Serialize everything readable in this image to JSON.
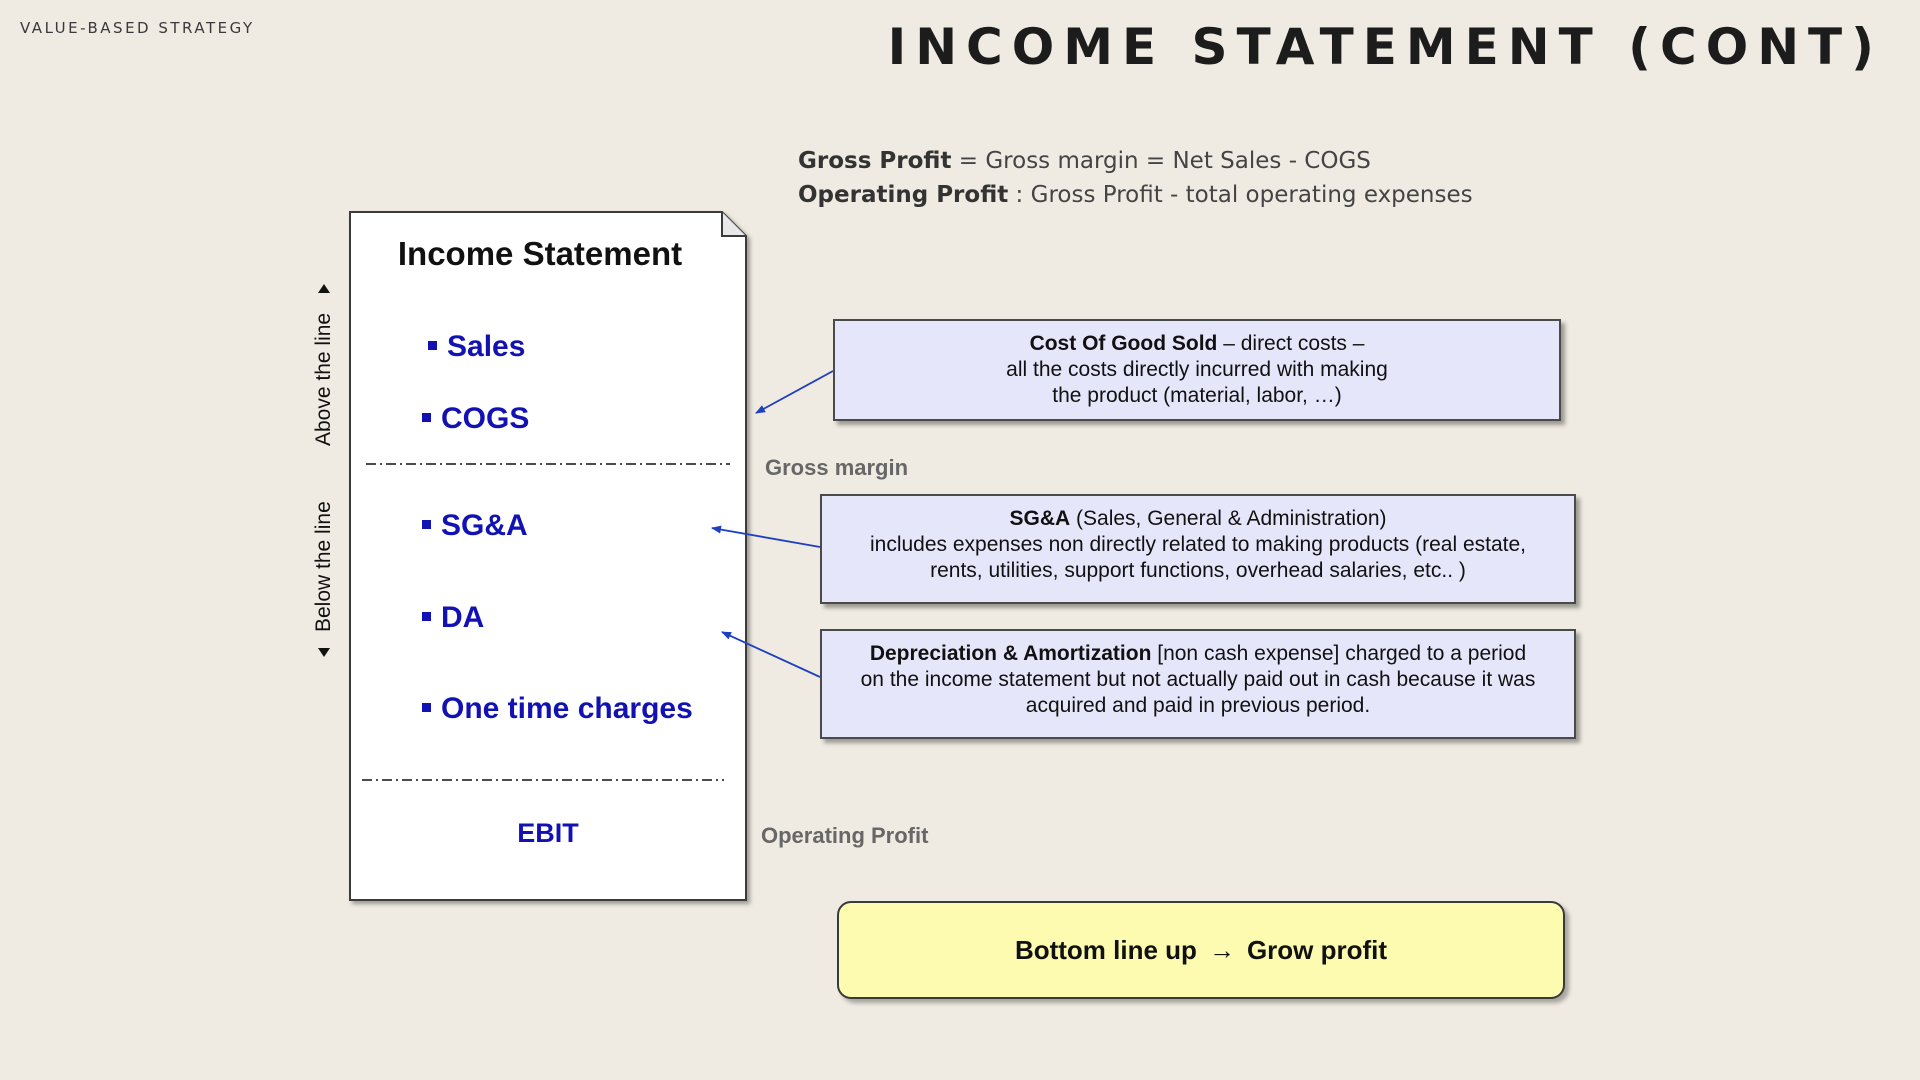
{
  "header": {
    "section_label": "VALUE-BASED STRATEGY",
    "title": "INCOME STATEMENT (CONT)"
  },
  "formulas": {
    "gross_profit_term": "Gross Profit",
    "gross_profit_def": " = Gross margin = Net Sales - COGS",
    "operating_profit_term": "Operating Profit",
    "operating_profit_def": " : Gross Profit - total operating expenses"
  },
  "income_statement": {
    "title": "Income Statement",
    "items": [
      "Sales",
      "COGS",
      "SG&A",
      "DA",
      "One time charges"
    ],
    "result": "EBIT"
  },
  "line_labels": {
    "above": "Above the line",
    "below": "Below  the line"
  },
  "side_notes": {
    "gross_margin": "Gross margin",
    "operating_profit": "Operating Profit"
  },
  "callouts": {
    "cogs": {
      "term": "Cost Of Good Sold",
      "line1": " – direct costs –",
      "line2": "all the costs directly incurred with making",
      "line3": "the product (material,  labor, …)"
    },
    "sga": {
      "term": "SG&A",
      "line1": " (Sales, General & Administration)",
      "line2": "includes expenses non directly related to making products (real estate,",
      "line3": "rents, utilities, support functions, overhead salaries, etc.. )"
    },
    "da": {
      "term": "Depreciation & Amortization",
      "line1": "  [non cash expense] charged to a period",
      "line2": "on the income statement but not actually paid out in cash because it was",
      "line3": "acquired and paid in previous period."
    }
  },
  "bottom_box": {
    "left": "Bottom line up",
    "arrow": "→",
    "right": "Grow profit"
  },
  "colors": {
    "background": "#efebe2",
    "item_blue": "#1212b4",
    "callout_fill": "#e6e6fb",
    "bottom_fill": "#fcfbb0",
    "arrow_blue": "#1e3fbf"
  }
}
